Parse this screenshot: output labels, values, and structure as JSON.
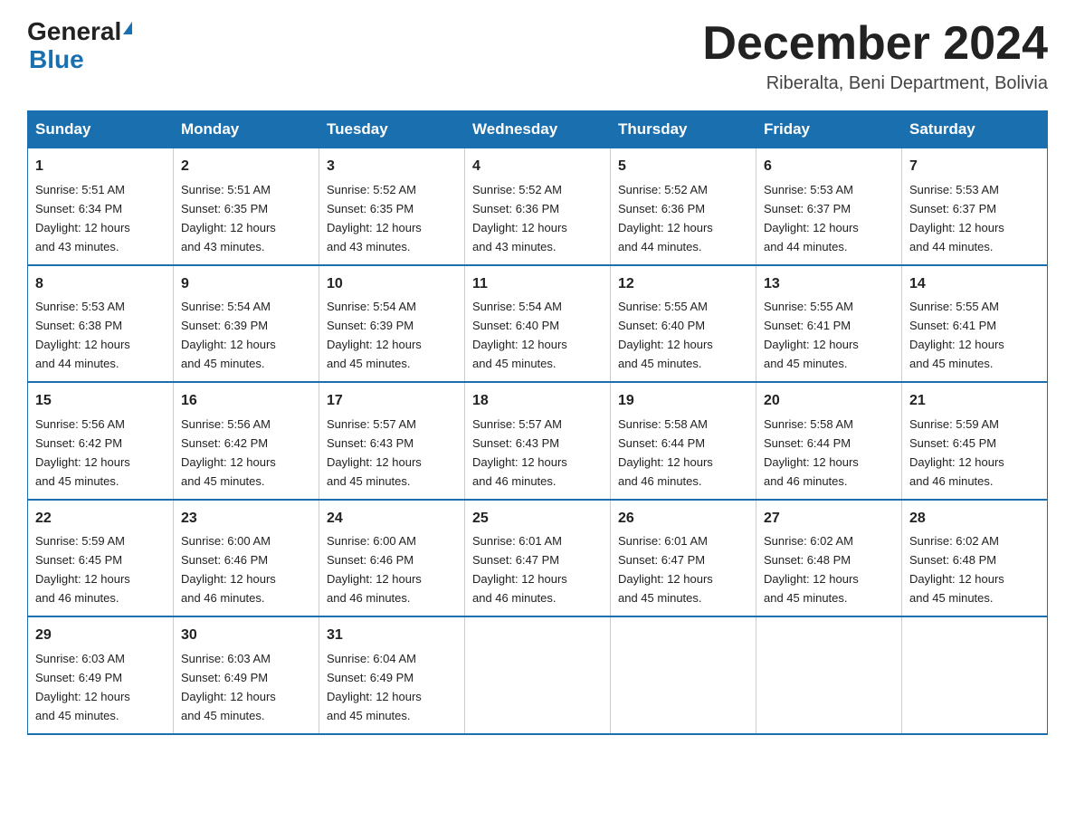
{
  "logo": {
    "text_general": "General",
    "text_blue": "Blue"
  },
  "header": {
    "month_year": "December 2024",
    "location": "Riberalta, Beni Department, Bolivia"
  },
  "weekdays": [
    "Sunday",
    "Monday",
    "Tuesday",
    "Wednesday",
    "Thursday",
    "Friday",
    "Saturday"
  ],
  "weeks": [
    [
      {
        "day": "1",
        "sunrise": "5:51 AM",
        "sunset": "6:34 PM",
        "daylight": "12 hours and 43 minutes."
      },
      {
        "day": "2",
        "sunrise": "5:51 AM",
        "sunset": "6:35 PM",
        "daylight": "12 hours and 43 minutes."
      },
      {
        "day": "3",
        "sunrise": "5:52 AM",
        "sunset": "6:35 PM",
        "daylight": "12 hours and 43 minutes."
      },
      {
        "day": "4",
        "sunrise": "5:52 AM",
        "sunset": "6:36 PM",
        "daylight": "12 hours and 43 minutes."
      },
      {
        "day": "5",
        "sunrise": "5:52 AM",
        "sunset": "6:36 PM",
        "daylight": "12 hours and 44 minutes."
      },
      {
        "day": "6",
        "sunrise": "5:53 AM",
        "sunset": "6:37 PM",
        "daylight": "12 hours and 44 minutes."
      },
      {
        "day": "7",
        "sunrise": "5:53 AM",
        "sunset": "6:37 PM",
        "daylight": "12 hours and 44 minutes."
      }
    ],
    [
      {
        "day": "8",
        "sunrise": "5:53 AM",
        "sunset": "6:38 PM",
        "daylight": "12 hours and 44 minutes."
      },
      {
        "day": "9",
        "sunrise": "5:54 AM",
        "sunset": "6:39 PM",
        "daylight": "12 hours and 45 minutes."
      },
      {
        "day": "10",
        "sunrise": "5:54 AM",
        "sunset": "6:39 PM",
        "daylight": "12 hours and 45 minutes."
      },
      {
        "day": "11",
        "sunrise": "5:54 AM",
        "sunset": "6:40 PM",
        "daylight": "12 hours and 45 minutes."
      },
      {
        "day": "12",
        "sunrise": "5:55 AM",
        "sunset": "6:40 PM",
        "daylight": "12 hours and 45 minutes."
      },
      {
        "day": "13",
        "sunrise": "5:55 AM",
        "sunset": "6:41 PM",
        "daylight": "12 hours and 45 minutes."
      },
      {
        "day": "14",
        "sunrise": "5:55 AM",
        "sunset": "6:41 PM",
        "daylight": "12 hours and 45 minutes."
      }
    ],
    [
      {
        "day": "15",
        "sunrise": "5:56 AM",
        "sunset": "6:42 PM",
        "daylight": "12 hours and 45 minutes."
      },
      {
        "day": "16",
        "sunrise": "5:56 AM",
        "sunset": "6:42 PM",
        "daylight": "12 hours and 45 minutes."
      },
      {
        "day": "17",
        "sunrise": "5:57 AM",
        "sunset": "6:43 PM",
        "daylight": "12 hours and 45 minutes."
      },
      {
        "day": "18",
        "sunrise": "5:57 AM",
        "sunset": "6:43 PM",
        "daylight": "12 hours and 46 minutes."
      },
      {
        "day": "19",
        "sunrise": "5:58 AM",
        "sunset": "6:44 PM",
        "daylight": "12 hours and 46 minutes."
      },
      {
        "day": "20",
        "sunrise": "5:58 AM",
        "sunset": "6:44 PM",
        "daylight": "12 hours and 46 minutes."
      },
      {
        "day": "21",
        "sunrise": "5:59 AM",
        "sunset": "6:45 PM",
        "daylight": "12 hours and 46 minutes."
      }
    ],
    [
      {
        "day": "22",
        "sunrise": "5:59 AM",
        "sunset": "6:45 PM",
        "daylight": "12 hours and 46 minutes."
      },
      {
        "day": "23",
        "sunrise": "6:00 AM",
        "sunset": "6:46 PM",
        "daylight": "12 hours and 46 minutes."
      },
      {
        "day": "24",
        "sunrise": "6:00 AM",
        "sunset": "6:46 PM",
        "daylight": "12 hours and 46 minutes."
      },
      {
        "day": "25",
        "sunrise": "6:01 AM",
        "sunset": "6:47 PM",
        "daylight": "12 hours and 46 minutes."
      },
      {
        "day": "26",
        "sunrise": "6:01 AM",
        "sunset": "6:47 PM",
        "daylight": "12 hours and 45 minutes."
      },
      {
        "day": "27",
        "sunrise": "6:02 AM",
        "sunset": "6:48 PM",
        "daylight": "12 hours and 45 minutes."
      },
      {
        "day": "28",
        "sunrise": "6:02 AM",
        "sunset": "6:48 PM",
        "daylight": "12 hours and 45 minutes."
      }
    ],
    [
      {
        "day": "29",
        "sunrise": "6:03 AM",
        "sunset": "6:49 PM",
        "daylight": "12 hours and 45 minutes."
      },
      {
        "day": "30",
        "sunrise": "6:03 AM",
        "sunset": "6:49 PM",
        "daylight": "12 hours and 45 minutes."
      },
      {
        "day": "31",
        "sunrise": "6:04 AM",
        "sunset": "6:49 PM",
        "daylight": "12 hours and 45 minutes."
      },
      null,
      null,
      null,
      null
    ]
  ],
  "labels": {
    "sunrise": "Sunrise:",
    "sunset": "Sunset:",
    "daylight": "Daylight:"
  }
}
